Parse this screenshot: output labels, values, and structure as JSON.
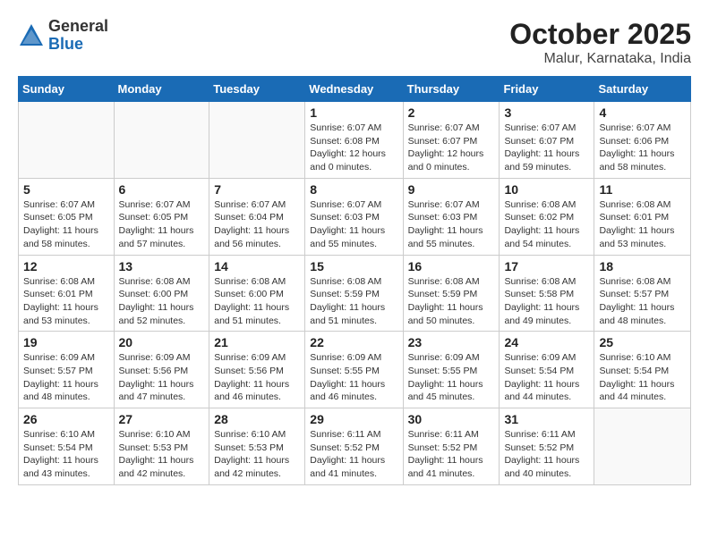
{
  "logo": {
    "general": "General",
    "blue": "Blue"
  },
  "title": {
    "month": "October 2025",
    "location": "Malur, Karnataka, India"
  },
  "weekdays": [
    "Sunday",
    "Monday",
    "Tuesday",
    "Wednesday",
    "Thursday",
    "Friday",
    "Saturday"
  ],
  "weeks": [
    [
      {
        "day": "",
        "sunrise": "",
        "sunset": "",
        "daylight": ""
      },
      {
        "day": "",
        "sunrise": "",
        "sunset": "",
        "daylight": ""
      },
      {
        "day": "",
        "sunrise": "",
        "sunset": "",
        "daylight": ""
      },
      {
        "day": "1",
        "sunrise": "Sunrise: 6:07 AM",
        "sunset": "Sunset: 6:08 PM",
        "daylight": "Daylight: 12 hours and 0 minutes."
      },
      {
        "day": "2",
        "sunrise": "Sunrise: 6:07 AM",
        "sunset": "Sunset: 6:07 PM",
        "daylight": "Daylight: 12 hours and 0 minutes."
      },
      {
        "day": "3",
        "sunrise": "Sunrise: 6:07 AM",
        "sunset": "Sunset: 6:07 PM",
        "daylight": "Daylight: 11 hours and 59 minutes."
      },
      {
        "day": "4",
        "sunrise": "Sunrise: 6:07 AM",
        "sunset": "Sunset: 6:06 PM",
        "daylight": "Daylight: 11 hours and 58 minutes."
      }
    ],
    [
      {
        "day": "5",
        "sunrise": "Sunrise: 6:07 AM",
        "sunset": "Sunset: 6:05 PM",
        "daylight": "Daylight: 11 hours and 58 minutes."
      },
      {
        "day": "6",
        "sunrise": "Sunrise: 6:07 AM",
        "sunset": "Sunset: 6:05 PM",
        "daylight": "Daylight: 11 hours and 57 minutes."
      },
      {
        "day": "7",
        "sunrise": "Sunrise: 6:07 AM",
        "sunset": "Sunset: 6:04 PM",
        "daylight": "Daylight: 11 hours and 56 minutes."
      },
      {
        "day": "8",
        "sunrise": "Sunrise: 6:07 AM",
        "sunset": "Sunset: 6:03 PM",
        "daylight": "Daylight: 11 hours and 55 minutes."
      },
      {
        "day": "9",
        "sunrise": "Sunrise: 6:07 AM",
        "sunset": "Sunset: 6:03 PM",
        "daylight": "Daylight: 11 hours and 55 minutes."
      },
      {
        "day": "10",
        "sunrise": "Sunrise: 6:08 AM",
        "sunset": "Sunset: 6:02 PM",
        "daylight": "Daylight: 11 hours and 54 minutes."
      },
      {
        "day": "11",
        "sunrise": "Sunrise: 6:08 AM",
        "sunset": "Sunset: 6:01 PM",
        "daylight": "Daylight: 11 hours and 53 minutes."
      }
    ],
    [
      {
        "day": "12",
        "sunrise": "Sunrise: 6:08 AM",
        "sunset": "Sunset: 6:01 PM",
        "daylight": "Daylight: 11 hours and 53 minutes."
      },
      {
        "day": "13",
        "sunrise": "Sunrise: 6:08 AM",
        "sunset": "Sunset: 6:00 PM",
        "daylight": "Daylight: 11 hours and 52 minutes."
      },
      {
        "day": "14",
        "sunrise": "Sunrise: 6:08 AM",
        "sunset": "Sunset: 6:00 PM",
        "daylight": "Daylight: 11 hours and 51 minutes."
      },
      {
        "day": "15",
        "sunrise": "Sunrise: 6:08 AM",
        "sunset": "Sunset: 5:59 PM",
        "daylight": "Daylight: 11 hours and 51 minutes."
      },
      {
        "day": "16",
        "sunrise": "Sunrise: 6:08 AM",
        "sunset": "Sunset: 5:59 PM",
        "daylight": "Daylight: 11 hours and 50 minutes."
      },
      {
        "day": "17",
        "sunrise": "Sunrise: 6:08 AM",
        "sunset": "Sunset: 5:58 PM",
        "daylight": "Daylight: 11 hours and 49 minutes."
      },
      {
        "day": "18",
        "sunrise": "Sunrise: 6:08 AM",
        "sunset": "Sunset: 5:57 PM",
        "daylight": "Daylight: 11 hours and 48 minutes."
      }
    ],
    [
      {
        "day": "19",
        "sunrise": "Sunrise: 6:09 AM",
        "sunset": "Sunset: 5:57 PM",
        "daylight": "Daylight: 11 hours and 48 minutes."
      },
      {
        "day": "20",
        "sunrise": "Sunrise: 6:09 AM",
        "sunset": "Sunset: 5:56 PM",
        "daylight": "Daylight: 11 hours and 47 minutes."
      },
      {
        "day": "21",
        "sunrise": "Sunrise: 6:09 AM",
        "sunset": "Sunset: 5:56 PM",
        "daylight": "Daylight: 11 hours and 46 minutes."
      },
      {
        "day": "22",
        "sunrise": "Sunrise: 6:09 AM",
        "sunset": "Sunset: 5:55 PM",
        "daylight": "Daylight: 11 hours and 46 minutes."
      },
      {
        "day": "23",
        "sunrise": "Sunrise: 6:09 AM",
        "sunset": "Sunset: 5:55 PM",
        "daylight": "Daylight: 11 hours and 45 minutes."
      },
      {
        "day": "24",
        "sunrise": "Sunrise: 6:09 AM",
        "sunset": "Sunset: 5:54 PM",
        "daylight": "Daylight: 11 hours and 44 minutes."
      },
      {
        "day": "25",
        "sunrise": "Sunrise: 6:10 AM",
        "sunset": "Sunset: 5:54 PM",
        "daylight": "Daylight: 11 hours and 44 minutes."
      }
    ],
    [
      {
        "day": "26",
        "sunrise": "Sunrise: 6:10 AM",
        "sunset": "Sunset: 5:54 PM",
        "daylight": "Daylight: 11 hours and 43 minutes."
      },
      {
        "day": "27",
        "sunrise": "Sunrise: 6:10 AM",
        "sunset": "Sunset: 5:53 PM",
        "daylight": "Daylight: 11 hours and 42 minutes."
      },
      {
        "day": "28",
        "sunrise": "Sunrise: 6:10 AM",
        "sunset": "Sunset: 5:53 PM",
        "daylight": "Daylight: 11 hours and 42 minutes."
      },
      {
        "day": "29",
        "sunrise": "Sunrise: 6:11 AM",
        "sunset": "Sunset: 5:52 PM",
        "daylight": "Daylight: 11 hours and 41 minutes."
      },
      {
        "day": "30",
        "sunrise": "Sunrise: 6:11 AM",
        "sunset": "Sunset: 5:52 PM",
        "daylight": "Daylight: 11 hours and 41 minutes."
      },
      {
        "day": "31",
        "sunrise": "Sunrise: 6:11 AM",
        "sunset": "Sunset: 5:52 PM",
        "daylight": "Daylight: 11 hours and 40 minutes."
      },
      {
        "day": "",
        "sunrise": "",
        "sunset": "",
        "daylight": ""
      }
    ]
  ]
}
